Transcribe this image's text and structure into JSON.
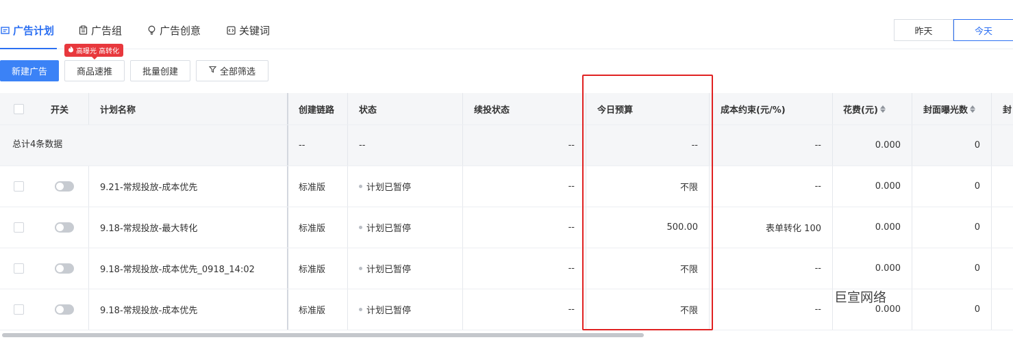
{
  "tabs": [
    {
      "label": "广告计划",
      "icon": "plan-icon",
      "active": true
    },
    {
      "label": "广告组",
      "icon": "clipboard-icon",
      "active": false
    },
    {
      "label": "广告创意",
      "icon": "bulb-icon",
      "active": false
    },
    {
      "label": "关键词",
      "icon": "code-icon",
      "active": false
    }
  ],
  "day_switch": {
    "yesterday": "昨天",
    "today": "今天"
  },
  "toolbar": {
    "new_ad": "新建广告",
    "hot_badge": "高曝光 高转化",
    "product_push": "商品速推",
    "batch_create": "批量创建",
    "all_filter": "全部筛选"
  },
  "table": {
    "headers": {
      "switch": "开关",
      "name": "计划名称",
      "chain": "创建链路",
      "status": "状态",
      "renew": "续投状态",
      "budget": "今日预算",
      "cost_limit": "成本约束(元/%)",
      "spend": "花费(元)",
      "cover_exposure": "封面曝光数",
      "more": "封"
    },
    "total": {
      "label": "总计4条数据",
      "chain": "--",
      "status": "--",
      "renew": "--",
      "budget": "--",
      "cost_limit": "--",
      "spend": "0.000",
      "cover_exposure": "0"
    },
    "rows": [
      {
        "name": "9.21-常规投放-成本优先",
        "chain": "标准版",
        "status": "计划已暂停",
        "renew": "--",
        "budget": "不限",
        "cost_limit": "--",
        "spend": "0.000",
        "cover_exposure": "0"
      },
      {
        "name": "9.18-常规投放-最大转化",
        "chain": "标准版",
        "status": "计划已暂停",
        "renew": "--",
        "budget": "500.00",
        "cost_limit": "表单转化 100",
        "spend": "0.000",
        "cover_exposure": "0"
      },
      {
        "name": "9.18-常规投放-成本优先_0918_14:02",
        "chain": "标准版",
        "status": "计划已暂停",
        "renew": "--",
        "budget": "不限",
        "cost_limit": "--",
        "spend": "0.000",
        "cover_exposure": "0"
      },
      {
        "name": "9.18-常规投放-成本优先",
        "chain": "标准版",
        "status": "计划已暂停",
        "renew": "--",
        "budget": "不限",
        "cost_limit": "--",
        "spend": "0.000",
        "cover_exposure": "0"
      }
    ]
  },
  "watermark": "巨宣网络",
  "colors": {
    "accent": "#2b6ff2",
    "primary_button": "#3b82f6",
    "highlight": "#e02020",
    "badge": "#e8383d"
  }
}
